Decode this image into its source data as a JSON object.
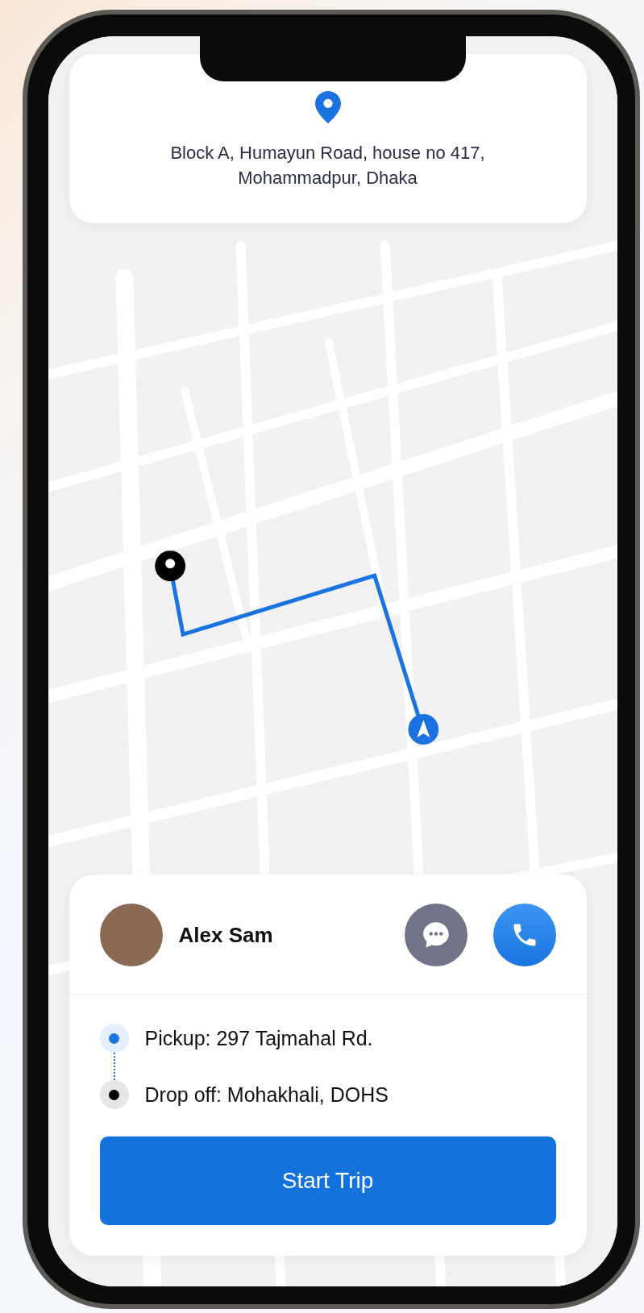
{
  "address": {
    "text": "Block A, Humayun Road, house no 417, Mohammadpur, Dhaka"
  },
  "driver": {
    "name": "Alex Sam"
  },
  "stops": [
    {
      "kind": "pickup",
      "label": "Pickup: 297 Tajmahal Rd."
    },
    {
      "kind": "dropoff",
      "label": "Drop off: Mohakhali, DOHS"
    }
  ],
  "primary_button": {
    "label": "Start Trip"
  }
}
